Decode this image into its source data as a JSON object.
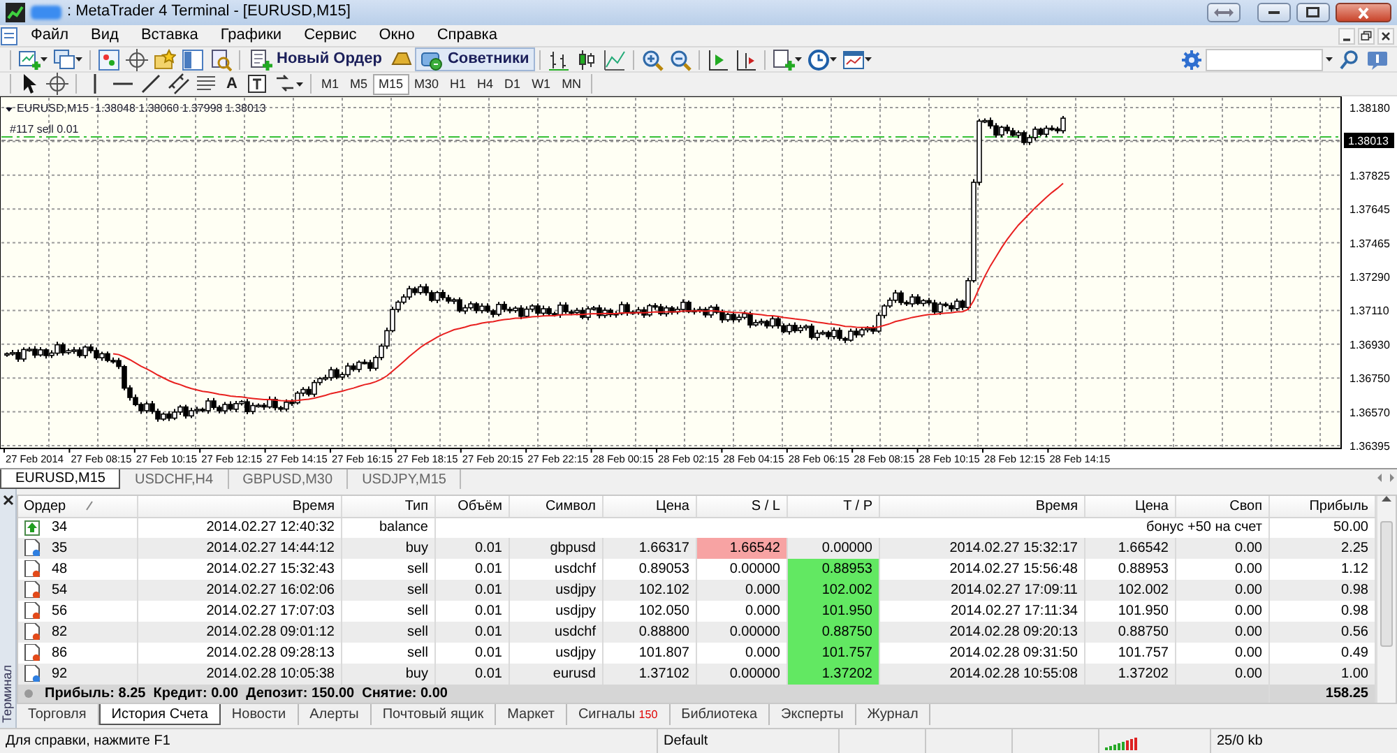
{
  "window": {
    "title": ": MetaTrader 4 Terminal - [EURUSD,M15]"
  },
  "menu": [
    "Файл",
    "Вид",
    "Вставка",
    "Графики",
    "Сервис",
    "Окно",
    "Справка"
  ],
  "toolbar": {
    "buttons": [
      {
        "kind": "new_order",
        "label": "Новый Ордер",
        "selected": false
      },
      {
        "kind": "experts",
        "label": "Советники",
        "selected": true
      }
    ]
  },
  "drawing_tools": {
    "text_tool": "A"
  },
  "timeframes": [
    {
      "label": "M1",
      "selected": false
    },
    {
      "label": "M5",
      "selected": false
    },
    {
      "label": "M15",
      "selected": true
    },
    {
      "label": "M30",
      "selected": false
    },
    {
      "label": "H1",
      "selected": false
    },
    {
      "label": "H4",
      "selected": false
    },
    {
      "label": "D1",
      "selected": false
    },
    {
      "label": "W1",
      "selected": false
    },
    {
      "label": "MN",
      "selected": false
    }
  ],
  "chart": {
    "header": "EURUSD,M15  1.38048 1.38060 1.37998 1.38013",
    "order_label": "#117 sell 0.01",
    "current_price": "1.38013",
    "price_labels": [
      "1.38180",
      "1.37825",
      "1.37645",
      "1.37465",
      "1.37290",
      "1.37110",
      "1.36930",
      "1.36750",
      "1.36570",
      "1.36395"
    ],
    "time_labels": [
      "27 Feb 2014",
      "27 Feb 08:15",
      "27 Feb 10:15",
      "27 Feb 12:15",
      "27 Feb 14:15",
      "27 Feb 16:15",
      "27 Feb 18:15",
      "27 Feb 20:15",
      "27 Feb 22:15",
      "28 Feb 00:15",
      "28 Feb 02:15",
      "28 Feb 04:15",
      "28 Feb 06:15",
      "28 Feb 08:15",
      "28 Feb 10:15",
      "28 Feb 12:15",
      "28 Feb 14:15"
    ]
  },
  "chart_tabs": [
    {
      "label": "EURUSD,M15",
      "selected": true
    },
    {
      "label": "USDCHF,H4",
      "selected": false
    },
    {
      "label": "GBPUSD,M30",
      "selected": false
    },
    {
      "label": "USDJPY,M15",
      "selected": false
    }
  ],
  "terminal": {
    "side_label": "Терминал",
    "columns": [
      "Ордер",
      "Время",
      "Тип",
      "Объём",
      "Символ",
      "Цена",
      "S / L",
      "T / P",
      "Время",
      "Цена",
      "Своп",
      "Прибыль"
    ],
    "rows": [
      {
        "kind": "balance",
        "order": "34",
        "time": "2014.02.27 12:40:32",
        "type": "balance",
        "comment": "бонус +50 на счет",
        "profit": "50.00"
      },
      {
        "kind": "buy",
        "order": "35",
        "time": "2014.02.27 14:44:12",
        "type": "buy",
        "volume": "0.01",
        "symbol": "gbpusd",
        "price": "1.66317",
        "sl": "1.66542",
        "sl_hit": true,
        "tp": "0.00000",
        "tp_hit": false,
        "close_time": "2014.02.27 15:32:17",
        "close_price": "1.66542",
        "swap": "0.00",
        "profit": "2.25"
      },
      {
        "kind": "sell",
        "order": "48",
        "time": "2014.02.27 15:32:43",
        "type": "sell",
        "volume": "0.01",
        "symbol": "usdchf",
        "price": "0.89053",
        "sl": "0.00000",
        "sl_hit": false,
        "tp": "0.88953",
        "tp_hit": true,
        "close_time": "2014.02.27 15:56:48",
        "close_price": "0.88953",
        "swap": "0.00",
        "profit": "1.12"
      },
      {
        "kind": "sell",
        "order": "54",
        "time": "2014.02.27 16:02:06",
        "type": "sell",
        "volume": "0.01",
        "symbol": "usdjpy",
        "price": "102.102",
        "sl": "0.000",
        "sl_hit": false,
        "tp": "102.002",
        "tp_hit": true,
        "close_time": "2014.02.27 17:09:11",
        "close_price": "102.002",
        "swap": "0.00",
        "profit": "0.98"
      },
      {
        "kind": "sell",
        "order": "56",
        "time": "2014.02.27 17:07:03",
        "type": "sell",
        "volume": "0.01",
        "symbol": "usdjpy",
        "price": "102.050",
        "sl": "0.000",
        "sl_hit": false,
        "tp": "101.950",
        "tp_hit": true,
        "close_time": "2014.02.27 17:11:34",
        "close_price": "101.950",
        "swap": "0.00",
        "profit": "0.98"
      },
      {
        "kind": "sell",
        "order": "82",
        "time": "2014.02.28 09:01:12",
        "type": "sell",
        "volume": "0.01",
        "symbol": "usdchf",
        "price": "0.88800",
        "sl": "0.00000",
        "sl_hit": false,
        "tp": "0.88750",
        "tp_hit": true,
        "close_time": "2014.02.28 09:20:13",
        "close_price": "0.88750",
        "swap": "0.00",
        "profit": "0.56"
      },
      {
        "kind": "sell",
        "order": "86",
        "time": "2014.02.28 09:28:13",
        "type": "sell",
        "volume": "0.01",
        "symbol": "usdjpy",
        "price": "101.807",
        "sl": "0.000",
        "sl_hit": false,
        "tp": "101.757",
        "tp_hit": true,
        "close_time": "2014.02.28 09:31:50",
        "close_price": "101.757",
        "swap": "0.00",
        "profit": "0.49"
      },
      {
        "kind": "buy",
        "order": "92",
        "time": "2014.02.28 10:05:38",
        "type": "buy",
        "volume": "0.01",
        "symbol": "eurusd",
        "price": "1.37102",
        "sl": "0.00000",
        "sl_hit": false,
        "tp": "1.37202",
        "tp_hit": true,
        "close_time": "2014.02.28 10:55:08",
        "close_price": "1.37202",
        "swap": "0.00",
        "profit": "1.00"
      }
    ],
    "summary": {
      "text": "Прибыль: 8.25  Кредит: 0.00  Депозит: 150.00  Снятие: 0.00",
      "total": "158.25"
    },
    "tabs": [
      {
        "label": "Торговля",
        "selected": false
      },
      {
        "label": "История Счета",
        "selected": true
      },
      {
        "label": "Новости",
        "selected": false
      },
      {
        "label": "Алерты",
        "selected": false
      },
      {
        "label": "Почтовый ящик",
        "selected": false
      },
      {
        "label": "Маркет",
        "selected": false
      },
      {
        "label": "Сигналы",
        "badge": "150",
        "selected": false
      },
      {
        "label": "Библиотека",
        "selected": false
      },
      {
        "label": "Эксперты",
        "selected": false
      },
      {
        "label": "Журнал",
        "selected": false
      }
    ]
  },
  "status_bar": {
    "help": "Для справки, нажмите F1",
    "profile": "Default",
    "traffic": "25/0 kb"
  }
}
